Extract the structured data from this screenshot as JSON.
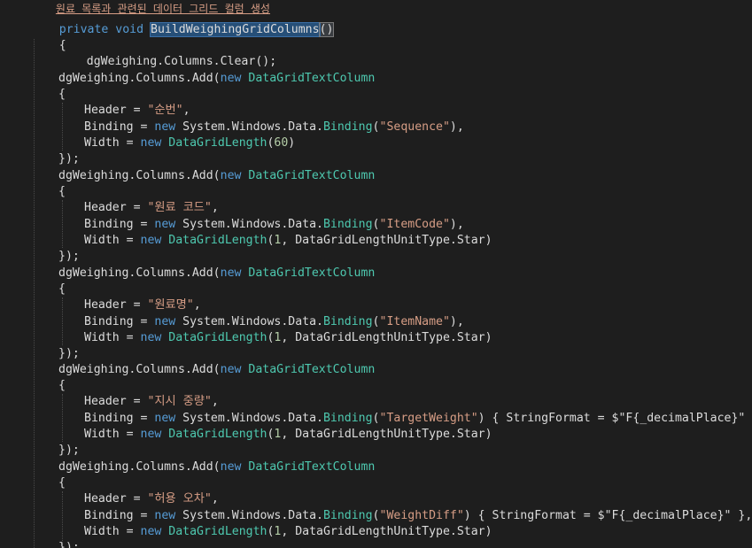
{
  "code": {
    "top_partial": "원료 목록과 관련된 데이터 그리드 컬럼 생성",
    "l1": {
      "kw": "private void",
      "method": "BuildWeighingGridColumns",
      "parens": "()"
    },
    "l2": "{",
    "l3": "dgWeighing.Columns.Clear();",
    "cols": [
      {
        "add": "dgWeighing.Columns.Add(",
        "new": "new",
        "type": "DataGridTextColumn",
        "open": "{",
        "header_pre": "Header = ",
        "header_val": "\"순번\"",
        "header_post": ",",
        "bind_pre": "Binding = ",
        "bind_new": "new",
        "bind_ns": " System.Windows.Data.",
        "bind_type": "Binding",
        "bind_open": "(",
        "bind_val": "\"Sequence\"",
        "bind_post": "),",
        "bind_fmt": "",
        "width_pre": "Width = ",
        "width_new": "new",
        "width_type": " DataGridLength",
        "width_args": "(",
        "width_num": "60",
        "width_rest": ")",
        "close": "});"
      },
      {
        "add": "dgWeighing.Columns.Add(",
        "new": "new",
        "type": "DataGridTextColumn",
        "open": "{",
        "header_pre": "Header = ",
        "header_val": "\"원료 코드\"",
        "header_post": ",",
        "bind_pre": "Binding = ",
        "bind_new": "new",
        "bind_ns": " System.Windows.Data.",
        "bind_type": "Binding",
        "bind_open": "(",
        "bind_val": "\"ItemCode\"",
        "bind_post": "),",
        "bind_fmt": "",
        "width_pre": "Width = ",
        "width_new": "new",
        "width_type": " DataGridLength",
        "width_args": "(",
        "width_num": "1",
        "width_rest": ", DataGridLengthUnitType.Star)",
        "close": "});"
      },
      {
        "add": "dgWeighing.Columns.Add(",
        "new": "new",
        "type": "DataGridTextColumn",
        "open": "{",
        "header_pre": "Header = ",
        "header_val": "\"원료명\"",
        "header_post": ",",
        "bind_pre": "Binding = ",
        "bind_new": "new",
        "bind_ns": " System.Windows.Data.",
        "bind_type": "Binding",
        "bind_open": "(",
        "bind_val": "\"ItemName\"",
        "bind_post": "),",
        "bind_fmt": "",
        "width_pre": "Width = ",
        "width_new": "new",
        "width_type": " DataGridLength",
        "width_args": "(",
        "width_num": "1",
        "width_rest": ", DataGridLengthUnitType.Star)",
        "close": "});"
      },
      {
        "add": "dgWeighing.Columns.Add(",
        "new": "new",
        "type": "DataGridTextColumn",
        "open": "{",
        "header_pre": "Header = ",
        "header_val": "\"지시 중량\"",
        "header_post": ",",
        "bind_pre": "Binding = ",
        "bind_new": "new",
        "bind_ns": " System.Windows.Data.",
        "bind_type": "Binding",
        "bind_open": "(",
        "bind_val": "\"TargetWeight\"",
        "bind_post": ")",
        "bind_fmt": " { StringFormat = $\"F{_decimalPlace}\" },",
        "width_pre": "Width = ",
        "width_new": "new",
        "width_type": " DataGridLength",
        "width_args": "(",
        "width_num": "1",
        "width_rest": ", DataGridLengthUnitType.Star)",
        "close": "});"
      },
      {
        "add": "dgWeighing.Columns.Add(",
        "new": "new",
        "type": "DataGridTextColumn",
        "open": "{",
        "header_pre": "Header = ",
        "header_val": "\"허용 오차\"",
        "header_post": ",",
        "bind_pre": "Binding = ",
        "bind_new": "new",
        "bind_ns": " System.Windows.Data.",
        "bind_type": "Binding",
        "bind_open": "(",
        "bind_val": "\"WeightDiff\"",
        "bind_post": ")",
        "bind_fmt": " { StringFormat = $\"F{_decimalPlace}\" },",
        "width_pre": "Width = ",
        "width_new": "new",
        "width_type": " DataGridLength",
        "width_args": "(",
        "width_num": "1",
        "width_rest": ", DataGridLengthUnitType.Star)",
        "close": "});"
      }
    ]
  },
  "colors": {
    "background": "#1e1e1e",
    "keyword": "#569cd6",
    "type": "#4ec9b0",
    "string": "#d69d85",
    "number": "#b5cea8",
    "text": "#dcdcdc",
    "selection": "#264f78"
  }
}
